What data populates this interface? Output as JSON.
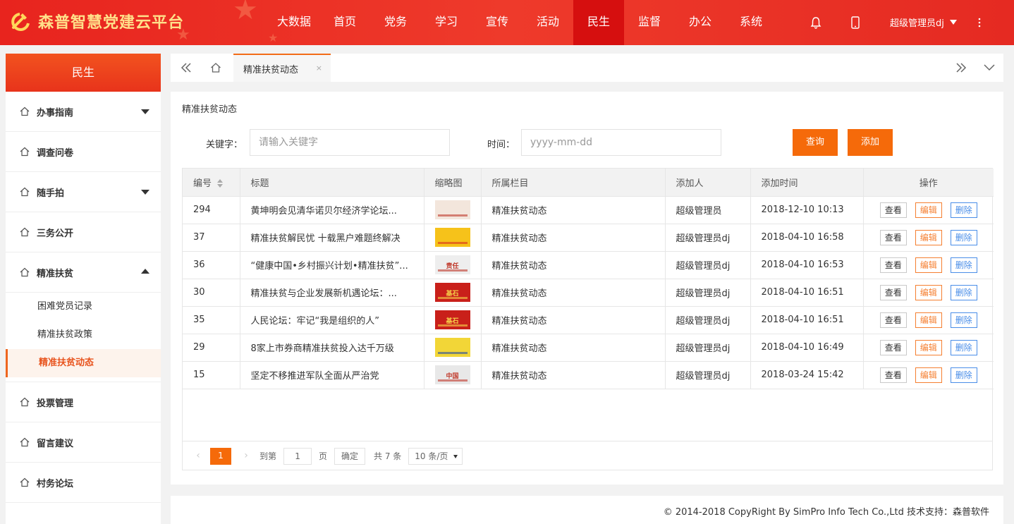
{
  "app": {
    "title": "森普智慧党建云平台"
  },
  "nav": {
    "items": [
      "大数据",
      "首页",
      "党务",
      "学习",
      "宣传",
      "活动",
      "民生",
      "监督",
      "办公",
      "系统"
    ],
    "active_index": 6
  },
  "header_right": {
    "user": "超级管理员dj"
  },
  "sidebar": {
    "header": "民生",
    "items": [
      {
        "label": "办事指南",
        "arrow": "down"
      },
      {
        "label": "调查问卷",
        "arrow": ""
      },
      {
        "label": "随手拍",
        "arrow": "down"
      },
      {
        "label": "三务公开",
        "arrow": ""
      },
      {
        "label": "精准扶贫",
        "arrow": "up"
      },
      {
        "label": "投票管理",
        "arrow": ""
      },
      {
        "label": "留言建议",
        "arrow": ""
      },
      {
        "label": "村务论坛",
        "arrow": ""
      }
    ],
    "subitems": [
      {
        "label": "困难党员记录"
      },
      {
        "label": "精准扶贫政策"
      },
      {
        "label": "精准扶贫动态"
      }
    ],
    "active_sub": 2
  },
  "tabs": {
    "current": "精准扶贫动态",
    "close": "×"
  },
  "panel": {
    "title": "精准扶贫动态",
    "keyword_label": "关键字：",
    "keyword_placeholder": "请输入关键字",
    "time_label": "时间：",
    "time_placeholder": "yyyy-mm-dd",
    "query_button": "查询",
    "add_button": "添加"
  },
  "table": {
    "columns": [
      "编号",
      "标题",
      "缩略图",
      "所属栏目",
      "添加人",
      "添加时间",
      "操作"
    ],
    "actions": {
      "view": "查看",
      "edit": "编辑",
      "delete": "删除"
    },
    "rows": [
      {
        "id": "294",
        "title": "黄坤明会见清华诺贝尔经济学论坛...",
        "thumb": {
          "bg": "#f3e6dc",
          "fg": "#c0392b",
          "text": ""
        },
        "column": "精准扶贫动态",
        "author": "超级管理员",
        "time": "2018-12-10 10:13"
      },
      {
        "id": "37",
        "title": "精准扶贫解民忧 十载黑户难题终解决",
        "thumb": {
          "bg": "#f6c21a",
          "fg": "#d9301c",
          "text": ""
        },
        "column": "精准扶贫动态",
        "author": "超级管理员dj",
        "time": "2018-04-10 16:58"
      },
      {
        "id": "36",
        "title": "“健康中国•乡村振兴计划•精准扶贫”...",
        "thumb": {
          "bg": "#eeeeee",
          "fg": "#c0392b",
          "text": "责任"
        },
        "column": "精准扶贫动态",
        "author": "超级管理员dj",
        "time": "2018-04-10 16:53"
      },
      {
        "id": "30",
        "title": "精准扶贫与企业发展新机遇论坛：...",
        "thumb": {
          "bg": "#c9201a",
          "fg": "#f7d24a",
          "text": "基石"
        },
        "column": "精准扶贫动态",
        "author": "超级管理员dj",
        "time": "2018-04-10 16:51"
      },
      {
        "id": "35",
        "title": "人民论坛：牢记“我是组织的人”",
        "thumb": {
          "bg": "#c9201a",
          "fg": "#f7d24a",
          "text": "基石"
        },
        "column": "精准扶贫动态",
        "author": "超级管理员dj",
        "time": "2018-04-10 16:51"
      },
      {
        "id": "29",
        "title": "8家上市券商精准扶贫投入达千万级",
        "thumb": {
          "bg": "#f2d637",
          "fg": "#2a4f9e",
          "text": ""
        },
        "column": "精准扶贫动态",
        "author": "超级管理员dj",
        "time": "2018-04-10 16:49"
      },
      {
        "id": "15",
        "title": "坚定不移推进军队全面从严治党",
        "thumb": {
          "bg": "#e8e8e8",
          "fg": "#c0392b",
          "text": "中国"
        },
        "column": "精准扶贫动态",
        "author": "超级管理员dj",
        "time": "2018-03-24 15:42"
      }
    ]
  },
  "pager": {
    "current_page": "1",
    "goto_label": "到第",
    "page_input": "1",
    "page_unit": "页",
    "confirm": "确定",
    "total": "共 7 条",
    "page_size": "10 条/页"
  },
  "footer": {
    "text": "© 2014-2018 CopyRight By SimPro Info Tech Co.,Ltd 技术支持：森普软件"
  },
  "colors": {
    "header_red": "#e8241e",
    "nav_active": "#d60f0f",
    "accent_orange": "#f56a0a",
    "edit_orange": "#f57f30",
    "delete_blue": "#4a8ee8"
  }
}
